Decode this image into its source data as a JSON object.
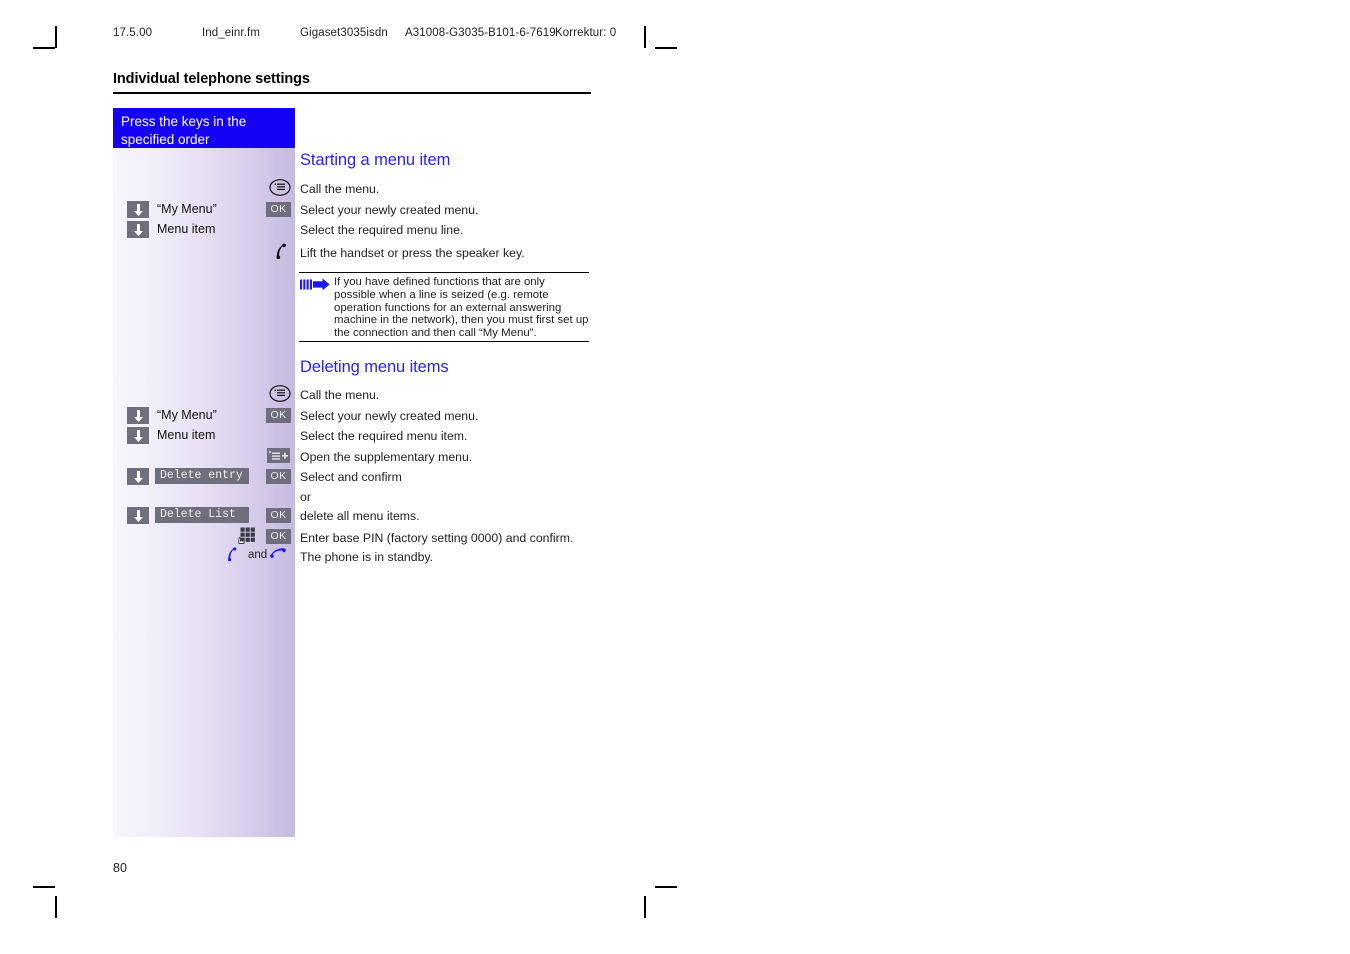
{
  "print_header": {
    "date": "17.5.00",
    "filename": "Ind_einr.fm",
    "product": "Gigaset3035isdn",
    "doc_code": "A31008-G3035-B101-6-7619",
    "correction": "Korrektur: 0"
  },
  "chapter_title": "Individual telephone settings",
  "left_column": {
    "header_line1": "Press the keys in the",
    "header_line2": "specified order",
    "keys": [
      {
        "icon": "down-arrow-key-icon",
        "label": "“My Menu”",
        "style": "plain"
      },
      {
        "icon": "down-arrow-key-icon",
        "label": "Menu item",
        "style": "plain"
      },
      {
        "icon": "down-arrow-key-icon",
        "label": "Delete entry",
        "style": "display"
      },
      {
        "icon": "down-arrow-key-icon",
        "label": "Delete List",
        "style": "display"
      }
    ],
    "ok_label": "OK"
  },
  "sections": [
    {
      "heading": "Starting a menu item",
      "steps": [
        {
          "icon": "menu-key-icon",
          "text": "Call the menu."
        },
        {
          "icon": "ok-key-icon",
          "text": "Select your newly created menu."
        },
        {
          "icon": "none",
          "text": "Select the required menu line."
        },
        {
          "icon": "handset-lift-icon",
          "text": "Lift the handset or press the speaker key."
        }
      ]
    },
    {
      "heading": "Deleting menu items",
      "steps": [
        {
          "icon": "menu-key-icon",
          "text": "Call the menu."
        },
        {
          "icon": "ok-key-icon",
          "text": "Select your newly created menu."
        },
        {
          "icon": "none",
          "text": "Select the required menu item."
        },
        {
          "icon": "supplementary-menu-icon",
          "text": "Open the supplementary menu."
        },
        {
          "icon": "ok-key-icon",
          "text": "Select and confirm"
        },
        {
          "icon": "none",
          "text": "or"
        },
        {
          "icon": "ok-key-icon",
          "text": "delete all menu items."
        },
        {
          "icon": "keypad-icon",
          "text": "Enter base PIN (factory setting 0000) and confirm."
        },
        {
          "icon": "handset-lift-hangup-icon",
          "text": "The phone is in standby."
        }
      ]
    }
  ],
  "note": {
    "icon": "note-arrow-icon",
    "text": "If you have defined functions that are only possible when a line is seized (e.g. remote operation functions for an external answering machine in the network), then you must first set up the connection and then call “My Menu”."
  },
  "and_label": "and",
  "page_number": "80",
  "colors": {
    "heading_blue": "#2b22f0",
    "header_box_blue": "#1300f5",
    "key_gray": "#6e6e7c",
    "note_arrow_blue": "#1a1af0",
    "handset_blue": "#1a1ae6"
  }
}
